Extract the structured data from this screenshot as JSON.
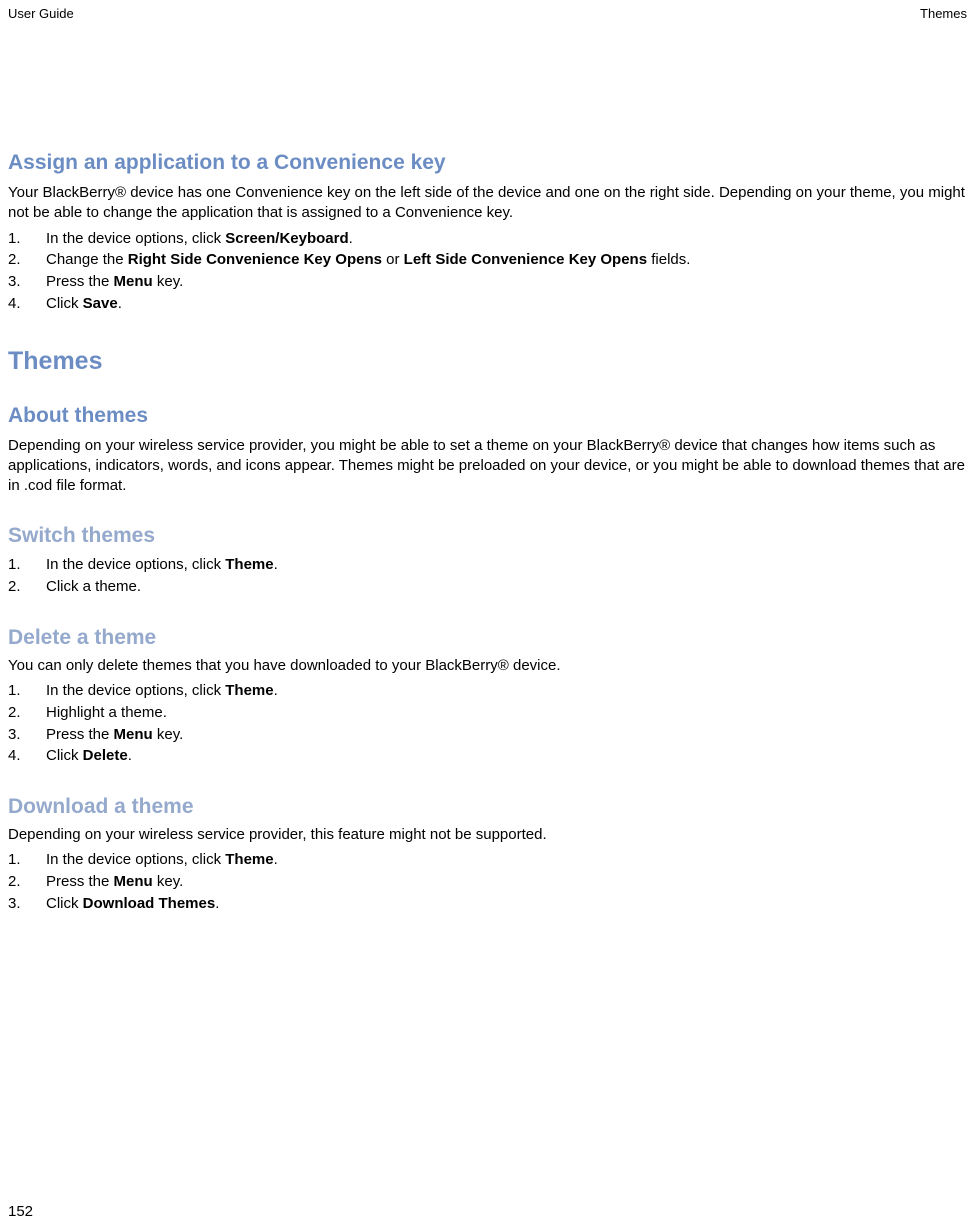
{
  "header": {
    "left": "User Guide",
    "right": "Themes"
  },
  "pageNumber": "152",
  "s1": {
    "title": "Assign an application to a Convenience key",
    "intro": "Your BlackBerry® device has one Convenience key on the left side of the device and one on the right side. Depending on your theme, you might not be able to change the application that is assigned to a Convenience key.",
    "step1_a": "In the device options, click ",
    "step1_b": "Screen/Keyboard",
    "step1_c": ".",
    "step2_a": "Change the ",
    "step2_b": "Right Side Convenience Key Opens",
    "step2_c": " or ",
    "step2_d": "Left Side Convenience Key Opens",
    "step2_e": " fields.",
    "step3_a": "Press the ",
    "step3_b": "Menu",
    "step3_c": " key.",
    "step4_a": "Click ",
    "step4_b": "Save",
    "step4_c": "."
  },
  "s2": {
    "title": "Themes"
  },
  "s3": {
    "title": "About themes",
    "body": "Depending on your wireless service provider, you might be able to set a theme on your BlackBerry® device that changes how items such as applications, indicators, words, and icons appear. Themes might be preloaded on your device, or you might be able to download themes that are in .cod file format."
  },
  "s4": {
    "title": "Switch themes",
    "step1_a": "In the device options, click ",
    "step1_b": "Theme",
    "step1_c": ".",
    "step2": "Click a theme."
  },
  "s5": {
    "title": "Delete a theme",
    "intro": "You can only delete themes that you have downloaded to your BlackBerry® device.",
    "step1_a": "In the device options, click ",
    "step1_b": "Theme",
    "step1_c": ".",
    "step2": "Highlight a theme.",
    "step3_a": "Press the ",
    "step3_b": "Menu",
    "step3_c": " key.",
    "step4_a": "Click ",
    "step4_b": "Delete",
    "step4_c": "."
  },
  "s6": {
    "title": "Download a theme",
    "intro": "Depending on your wireless service provider, this feature might not be supported.",
    "step1_a": "In the device options, click ",
    "step1_b": "Theme",
    "step1_c": ".",
    "step2_a": "Press the ",
    "step2_b": "Menu",
    "step2_c": " key.",
    "step3_a": "Click ",
    "step3_b": "Download Themes",
    "step3_c": "."
  }
}
